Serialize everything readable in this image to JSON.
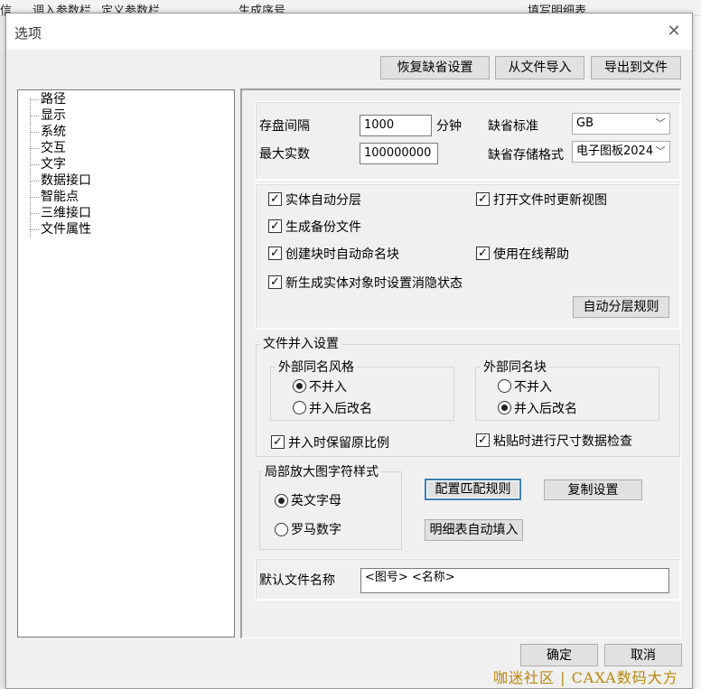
{
  "background": {
    "toolbar_items": [
      "调入参数栏",
      "定义参数栏",
      "生成序号",
      "填写明细表"
    ]
  },
  "dialog": {
    "title": "选项",
    "top_buttons": {
      "restore_defaults": "恢复缺省设置",
      "import_from_file": "从文件导入",
      "export_to_file": "导出到文件"
    },
    "tree": {
      "items": [
        "路径",
        "显示",
        "系统",
        "交互",
        "文字",
        "数据接口",
        "智能点",
        "三维接口",
        "文件属性"
      ]
    },
    "panel": {
      "save_interval_label": "存盘间隔",
      "save_interval_value": "1000",
      "save_interval_unit": "分钟",
      "max_entities_label": "最大实数",
      "max_entities_value": "100000000",
      "default_standard_label": "缺省标准",
      "default_standard_value": "GB",
      "default_format_label": "缺省存储格式",
      "default_format_value": "电子图板2024",
      "checks": {
        "auto_layer": "实体自动分层",
        "update_view_on_open": "打开文件时更新视图",
        "backup": "生成备份文件",
        "auto_name_block": "创建块时自动命名块",
        "online_help": "使用在线帮助",
        "hidden_state": "新生成实体对象时设置消隐状态"
      },
      "auto_layer_rules_button": "自动分层规则",
      "merge": {
        "title": "文件并入设置",
        "style_group": {
          "title": "外部同名风格",
          "options": [
            "不并入",
            "并入后改名"
          ],
          "selected": 0
        },
        "block_group": {
          "title": "外部同名块",
          "options": [
            "不并入",
            "并入后改名"
          ],
          "selected": 1
        },
        "keep_scale": "并入时保留原比例",
        "paste_check": "粘贴时进行尺寸数据检查"
      },
      "zoom_char": {
        "title": "局部放大图字符样式",
        "options": [
          "英文字母",
          "罗马数字"
        ],
        "selected": 0
      },
      "match_rules_button": "配置匹配规则",
      "copy_settings_button": "复制设置",
      "detail_autofill_button": "明细表自动填入",
      "default_filename_label": "默认文件名称",
      "default_filename_value": "<图号> <名称>"
    },
    "ok_button": "确定",
    "cancel_button": "取消"
  },
  "watermark": "咖迷社区 | CAXA数码大方"
}
